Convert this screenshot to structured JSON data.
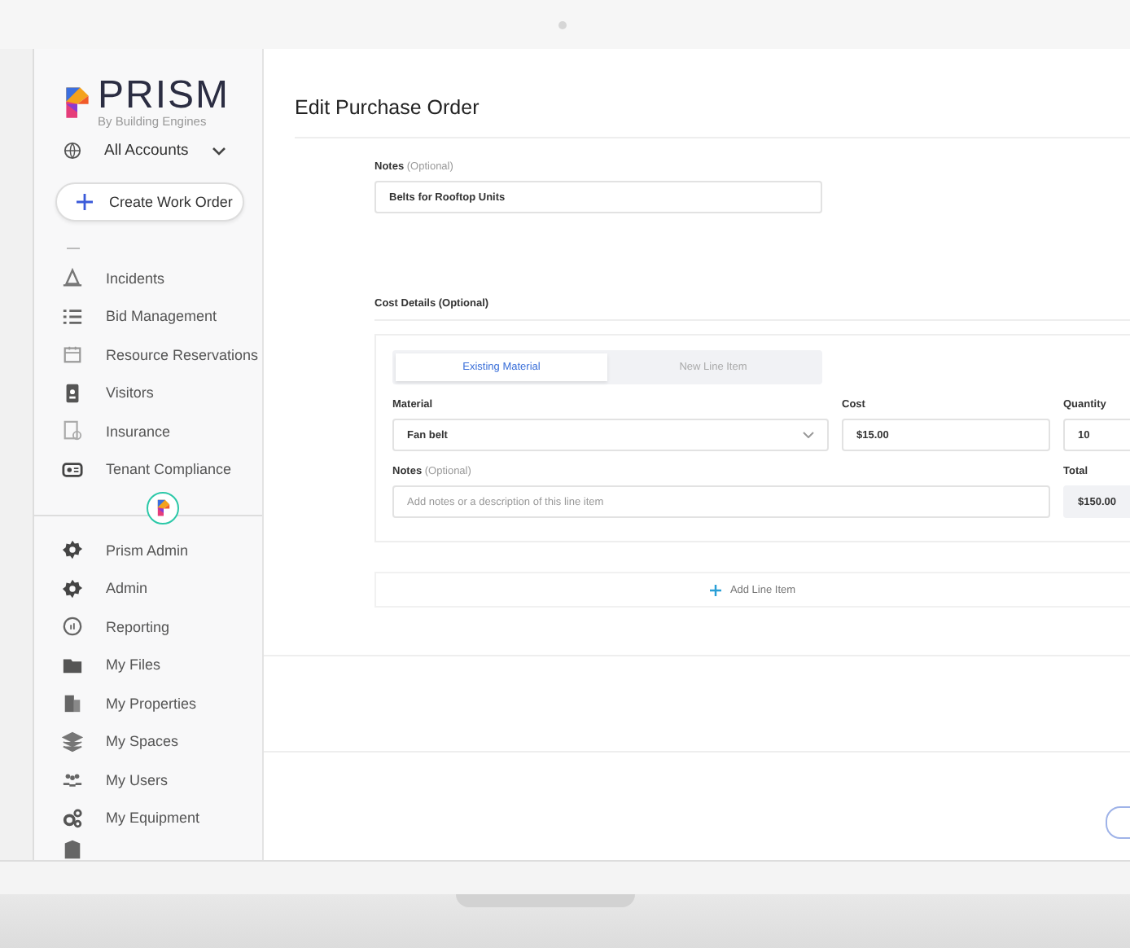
{
  "sidebar": {
    "brand": {
      "name": "PRISM",
      "tagline": "By Building Engines"
    },
    "account_selector": {
      "label": "All Accounts"
    },
    "create_button": "Create Work Order",
    "nav_groups": [
      [
        {
          "label": "Incidents"
        },
        {
          "label": "Bid Management"
        },
        {
          "label": "Resource Reservations"
        },
        {
          "label": "Visitors"
        },
        {
          "label": "Insurance"
        },
        {
          "label": "Tenant Compliance"
        }
      ],
      [
        {
          "label": "Prism Admin"
        },
        {
          "label": "Admin"
        },
        {
          "label": "Reporting"
        },
        {
          "label": "My Files"
        },
        {
          "label": "My Properties"
        },
        {
          "label": "My Spaces"
        },
        {
          "label": "My Users"
        },
        {
          "label": "My Equipment"
        }
      ]
    ]
  },
  "page": {
    "title": "Edit Purchase Order",
    "notes": {
      "label": "**Notes** (Optional)",
      "value": "Belts for Rooftop Units"
    },
    "cost_details": {
      "label": "Cost Details (Optional)",
      "tabs": [
        {
          "label": "Existing Material",
          "selected": true
        },
        {
          "label": "New Line Item",
          "selected": false
        }
      ],
      "material": {
        "label": "Material",
        "value": "Fan belt"
      },
      "cost": {
        "label": "Cost",
        "value": "$15.00"
      },
      "quantity": {
        "label": "Quantity",
        "value": "10"
      },
      "line_notes": {
        "label": "**Notes** (Optional)",
        "placeholder": "Add notes or a description of this line item"
      },
      "total": {
        "label": "Total",
        "value": "$150.00"
      }
    },
    "add_line_item": "Add Line Item"
  }
}
